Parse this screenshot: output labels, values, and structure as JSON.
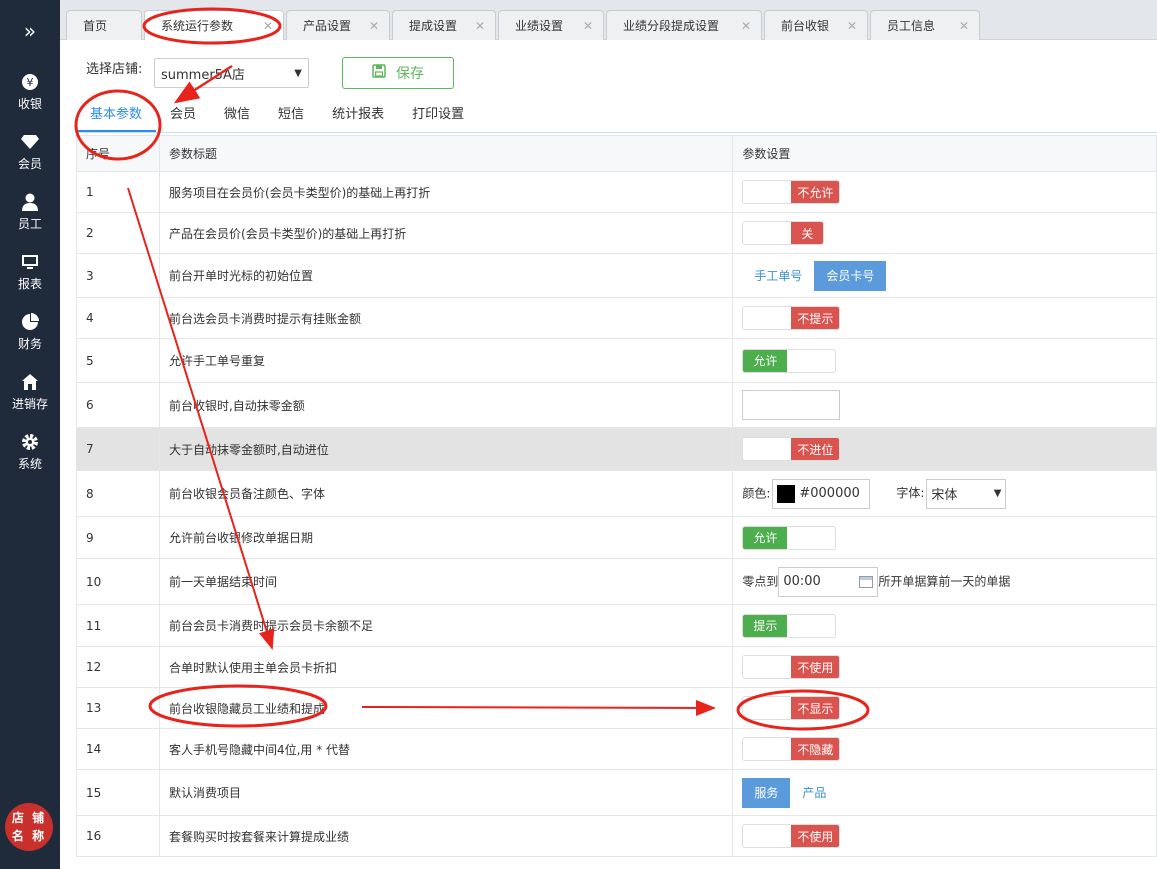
{
  "sidebar": {
    "toggle": "»",
    "items": [
      {
        "label": "收银",
        "icon": "cashier-icon"
      },
      {
        "label": "会员",
        "icon": "diamond-icon"
      },
      {
        "label": "员工",
        "icon": "user-icon"
      },
      {
        "label": "报表",
        "icon": "monitor-icon"
      },
      {
        "label": "财务",
        "icon": "pie-chart-icon"
      },
      {
        "label": "进销存",
        "icon": "home-icon"
      },
      {
        "label": "系统",
        "icon": "gear-icon"
      }
    ],
    "store_badge": {
      "line1": "店 铺",
      "line2": "名 称"
    }
  },
  "tabs": [
    {
      "label": "首页",
      "closable": false
    },
    {
      "label": "系统运行参数",
      "closable": true,
      "active": true
    },
    {
      "label": "产品设置",
      "closable": true
    },
    {
      "label": "提成设置",
      "closable": true
    },
    {
      "label": "业绩设置",
      "closable": true
    },
    {
      "label": "业绩分段提成设置",
      "closable": true
    },
    {
      "label": "前台收银",
      "closable": true
    },
    {
      "label": "员工信息",
      "closable": true
    }
  ],
  "toolbar": {
    "store_label": "选择店铺:",
    "store_value": "summer5A店",
    "save_label": "保存"
  },
  "subtabs": [
    "基本参数",
    "会员",
    "微信",
    "短信",
    "统计报表",
    "打印设置"
  ],
  "table": {
    "headers": [
      "序号",
      "参数标题",
      "参数设置"
    ],
    "rows": [
      {
        "no": "1",
        "title": "服务项目在会员价(会员卡类型价)的基础上再打折",
        "type": "switch-off",
        "value": "不允许"
      },
      {
        "no": "2",
        "title": "产品在会员价(会员卡类型价)的基础上再打折",
        "type": "switch-off-short",
        "value": "关"
      },
      {
        "no": "3",
        "title": "前台开单时光标的初始位置",
        "type": "segment",
        "options": [
          "手工单号",
          "会员卡号"
        ],
        "selected": 1
      },
      {
        "no": "4",
        "title": "前台选会员卡消费时提示有挂账金额",
        "type": "switch-off",
        "value": "不提示"
      },
      {
        "no": "5",
        "title": "允许手工单号重复",
        "type": "switch-on",
        "value": "允许"
      },
      {
        "no": "6",
        "title": "前台收银时,自动抹零金额",
        "type": "text",
        "value": ""
      },
      {
        "no": "7",
        "title": "大于自动抹零金额时,自动进位",
        "type": "switch-off",
        "value": "不进位",
        "highlight": true
      },
      {
        "no": "8",
        "title": "前台收银会员备注颜色、字体",
        "type": "color-font",
        "color_label": "颜色:",
        "color_value": "#000000",
        "font_label": "字体:",
        "font_value": "宋体"
      },
      {
        "no": "9",
        "title": "允许前台收银修改单据日期",
        "type": "switch-on",
        "value": "允许"
      },
      {
        "no": "10",
        "title": "前一天单据结束时间",
        "type": "time",
        "prefix": "零点到",
        "value": "00:00",
        "suffix": "所开单据算前一天的单据"
      },
      {
        "no": "11",
        "title": "前台会员卡消费时提示会员卡余额不足",
        "type": "switch-on",
        "value": "提示"
      },
      {
        "no": "12",
        "title": "合单时默认使用主单会员卡折扣",
        "type": "switch-off",
        "value": "不使用"
      },
      {
        "no": "13",
        "title": "前台收银隐藏员工业绩和提成",
        "type": "switch-off",
        "value": "不显示"
      },
      {
        "no": "14",
        "title": "客人手机号隐藏中间4位,用 * 代替",
        "type": "switch-off",
        "value": "不隐藏"
      },
      {
        "no": "15",
        "title": "默认消费项目",
        "type": "segment",
        "options": [
          "服务",
          "产品"
        ],
        "selected": 0
      },
      {
        "no": "16",
        "title": "套餐购买时按套餐来计算提成业绩",
        "type": "switch-off",
        "value": "不使用"
      }
    ]
  },
  "colors": {
    "sidebar": "#1f2a3a",
    "accent": "#2d8cf0",
    "on": "#4cae4c",
    "off": "#d9534f",
    "annotation": "#e8231b"
  }
}
